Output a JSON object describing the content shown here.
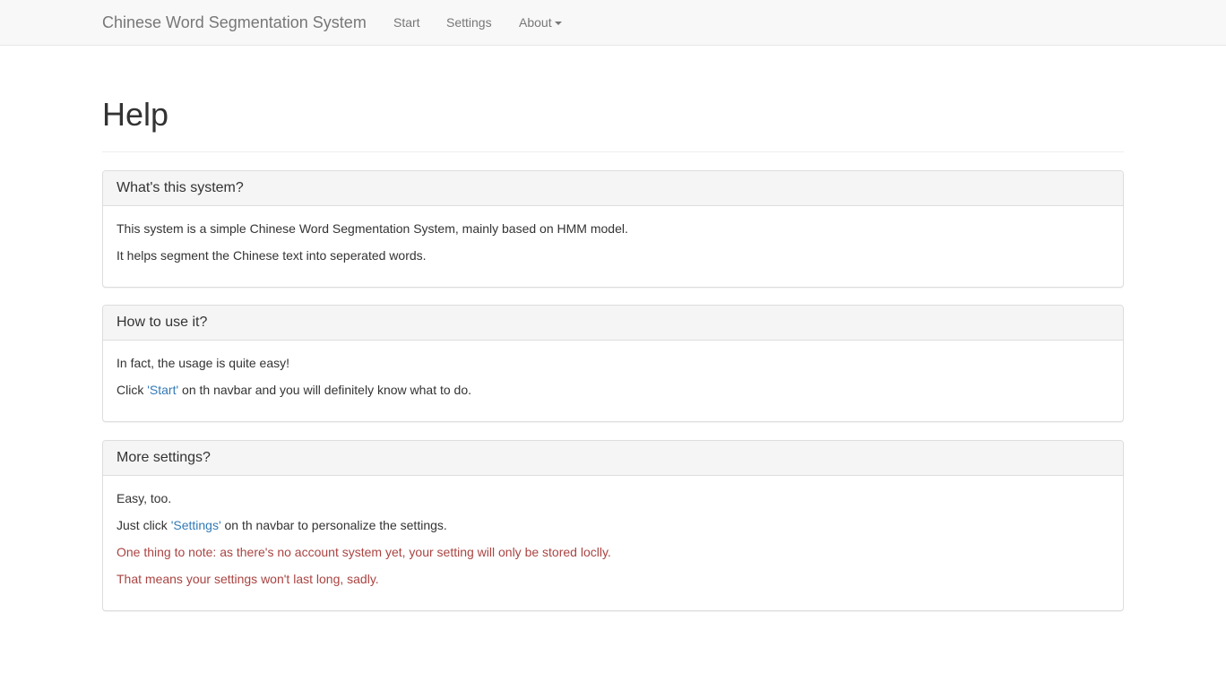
{
  "navbar": {
    "brand": "Chinese Word Segmentation System",
    "start": "Start",
    "settings": "Settings",
    "about": "About"
  },
  "page": {
    "title": "Help"
  },
  "panels": [
    {
      "heading": "What's this system?",
      "lines": [
        "This system is a simple Chinese Word Segmentation System, mainly based on HMM model.",
        "It helps segment the Chinese text into seperated words."
      ]
    },
    {
      "heading": "How to use it?",
      "line1": "In fact, the usage is quite easy!",
      "line2_before": "Click ",
      "line2_link": "'Start'",
      "line2_after": " on th navbar and you will definitely know what to do."
    },
    {
      "heading": "More settings?",
      "line1": "Easy, too.",
      "line2_before": "Just click ",
      "line2_link": "'Settings'",
      "line2_after": " on th navbar to personalize the settings.",
      "note1": "One thing to note: as there's no account system yet, your setting will only be stored loclly.",
      "note2": "That means your settings won't last long, sadly."
    }
  ],
  "colors": {
    "navbar_bg": "#f8f8f8",
    "link": "#337ab7",
    "danger_text": "#a94442",
    "panel_heading_bg": "#f5f5f5"
  },
  "icons": {
    "about_dropdown": "caret-down-icon"
  }
}
